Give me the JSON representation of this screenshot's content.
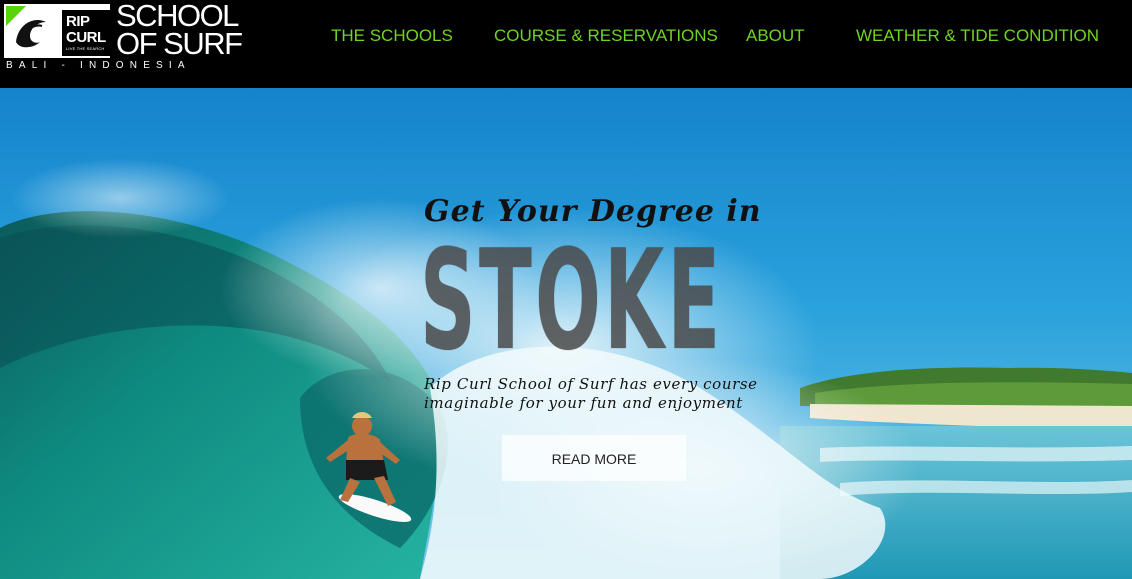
{
  "logo": {
    "brand": "RIP\nCURL",
    "tagline": "LIVE THE SEARCH",
    "title": "SCHOOL\nOF SURF",
    "location": "BALI - INDONESIA"
  },
  "nav": {
    "items": [
      {
        "label": "THE SCHOOLS"
      },
      {
        "label": "COURSE & RESERVATIONS"
      },
      {
        "label": "ABOUT"
      },
      {
        "label": "WEATHER & TIDE CONDITION"
      }
    ]
  },
  "hero": {
    "headline": "Get Your Degree in",
    "big_word": "STOKE",
    "subtext": "Rip Curl School of Surf has every course imaginable for your fun and enjoyment",
    "cta_label": "READ MORE"
  },
  "colors": {
    "nav_text": "#6fd41f",
    "header_bg": "#000000",
    "accent_green": "#5ad40a"
  }
}
